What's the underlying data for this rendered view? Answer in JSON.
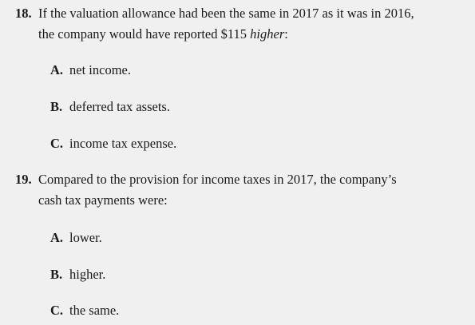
{
  "q18": {
    "number": "18.",
    "text_line1": "If the valuation allowance had been the same in 2017 as it was in 2016,",
    "text_line2_before": "the company would have reported $115 ",
    "text_line2_emph": "higher",
    "text_line2_after": ":",
    "options": [
      {
        "letter": "A.",
        "text": "net income."
      },
      {
        "letter": "B.",
        "text": "deferred tax assets."
      },
      {
        "letter": "C.",
        "text": "income tax expense."
      }
    ]
  },
  "q19": {
    "number": "19.",
    "text_line1": "Compared to the provision for income taxes in 2017, the company’s",
    "text_line2": "cash tax payments were:",
    "options": [
      {
        "letter": "A.",
        "text": "lower."
      },
      {
        "letter": "B.",
        "text": "higher."
      },
      {
        "letter": "C.",
        "text": "the same."
      }
    ]
  }
}
